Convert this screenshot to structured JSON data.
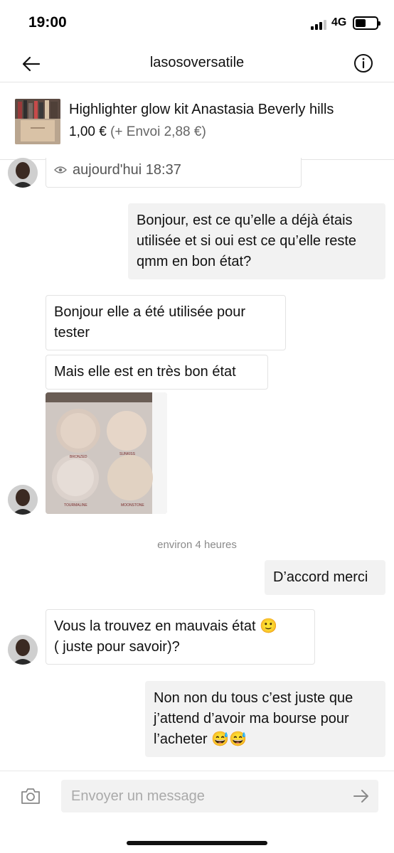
{
  "status_bar": {
    "time": "19:00",
    "network": "4G",
    "battery_level": 0.5,
    "signal_bars": 3
  },
  "header": {
    "title": "lasosoversatile",
    "back_icon": "arrow-left-icon",
    "info_icon": "info-circle-icon"
  },
  "product": {
    "title": "Highlighter  glow  kit Anastasia Beverly hills",
    "price": "1,00 €",
    "shipping": "(+ Envoi 2,88 €)"
  },
  "messages": {
    "seen_label": "aujourd'hui 18:37",
    "m1": "Bonjour, est ce qu’elle a déjà étais utilisée et si oui est ce qu’elle reste qmm en bon état?",
    "m2": "Bonjour elle a été  utilisée  pour tester",
    "m3": "Mais elle est en très bon  état",
    "photo_labels": [
      "BRONZED",
      "SUNKISS",
      "TOURMALINE",
      "MOONSTONE"
    ],
    "time_separator": "environ 4 heures",
    "m4": "D’accord merci",
    "m5_line1": "Vous la trouvez  en mauvais  état",
    "m5_emoji": "🙂",
    "m5_line2": "( juste pour  savoir)?",
    "m6": "Non non du tous c’est juste que j’attend d’avoir ma bourse pour l’acheter",
    "m6_emoji": "😅😅"
  },
  "composer": {
    "placeholder": "Envoyer un message",
    "camera_icon": "camera-icon",
    "send_icon": "send-arrow-icon"
  },
  "colors": {
    "outgoing_bubble": "#f2f2f2",
    "incoming_border": "#e3e3e3",
    "muted_text": "#8a8a8a"
  }
}
